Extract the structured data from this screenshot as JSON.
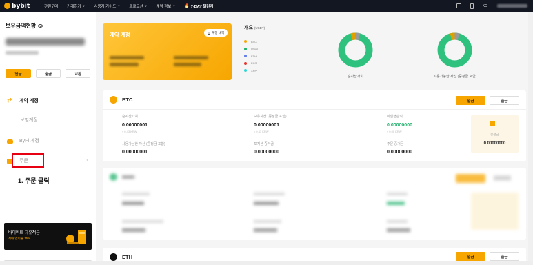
{
  "brand": {
    "name": "bybit",
    "accent": "#f7a600"
  },
  "nav": {
    "items": [
      {
        "label": "간편구매",
        "caret": false
      },
      {
        "label": "거래하기",
        "caret": true
      },
      {
        "label": "사용자 가이드",
        "caret": true
      },
      {
        "label": "프로모션",
        "caret": true
      },
      {
        "label": "계약 정보",
        "caret": true
      }
    ],
    "promo_label": "7-DAY 챌린지",
    "lang": "KO"
  },
  "sidebar": {
    "asset_title": "보유금액현황",
    "buttons": {
      "deposit": "입금",
      "withdraw": "출금",
      "exchange": "교환"
    },
    "items": [
      {
        "label": "계약 계정",
        "state": "active"
      },
      {
        "label": "보험계정",
        "state": "dim"
      },
      {
        "label": "ByFi 계정",
        "state": "dim"
      },
      {
        "label": "주문",
        "state": "dim"
      }
    ],
    "step_label": "1. 주문 클릭",
    "banner": {
      "title": "바이비트 자유적금",
      "subtitle": "최대 연이율 15%"
    }
  },
  "contract_card": {
    "title": "계약 계정",
    "button_label": "계정 내역"
  },
  "overview": {
    "title": "개요",
    "unit": "(USDT)",
    "legend": [
      {
        "label": "BTC",
        "color": "#f7a600"
      },
      {
        "label": "USDT",
        "color": "#20b26c"
      },
      {
        "label": "ETH",
        "color": "#627eea"
      },
      {
        "label": "EOS",
        "color": "#e6352b"
      },
      {
        "label": "XRP",
        "color": "#2ad8d8"
      }
    ],
    "donut_left_label": "순자산가치",
    "donut_right_label": "사용가능한 자산 (증정금 포함)"
  },
  "btc_card": {
    "coin": "BTC",
    "deposit": "입금",
    "withdraw": "출금",
    "fields": {
      "net_value_label": "순자산가치",
      "net_value": "0.00000001",
      "net_value_krw": "≈ 0.43 KRW",
      "holding_label": "보유자산 (증정금 포함)",
      "holding_value": "0.00000001",
      "holding_krw": "≈ 0.43 KRW",
      "unrealized_label": "미실현손익",
      "unrealized_value": "0.00000000",
      "unrealized_krw": "≈ 0.00 KRW",
      "available_label": "사용가능한 자산 (증정금 포함)",
      "available_value": "0.00000001",
      "position_margin_label": "포지션 증거금",
      "position_margin_value": "0.00000000",
      "order_margin_label": "주문 증거금",
      "order_margin_value": "0.00000000",
      "bonus_label": "증정금",
      "bonus_value": "0.00000000"
    }
  },
  "eth_card": {
    "coin": "ETH",
    "deposit": "입금",
    "withdraw": "출금"
  }
}
